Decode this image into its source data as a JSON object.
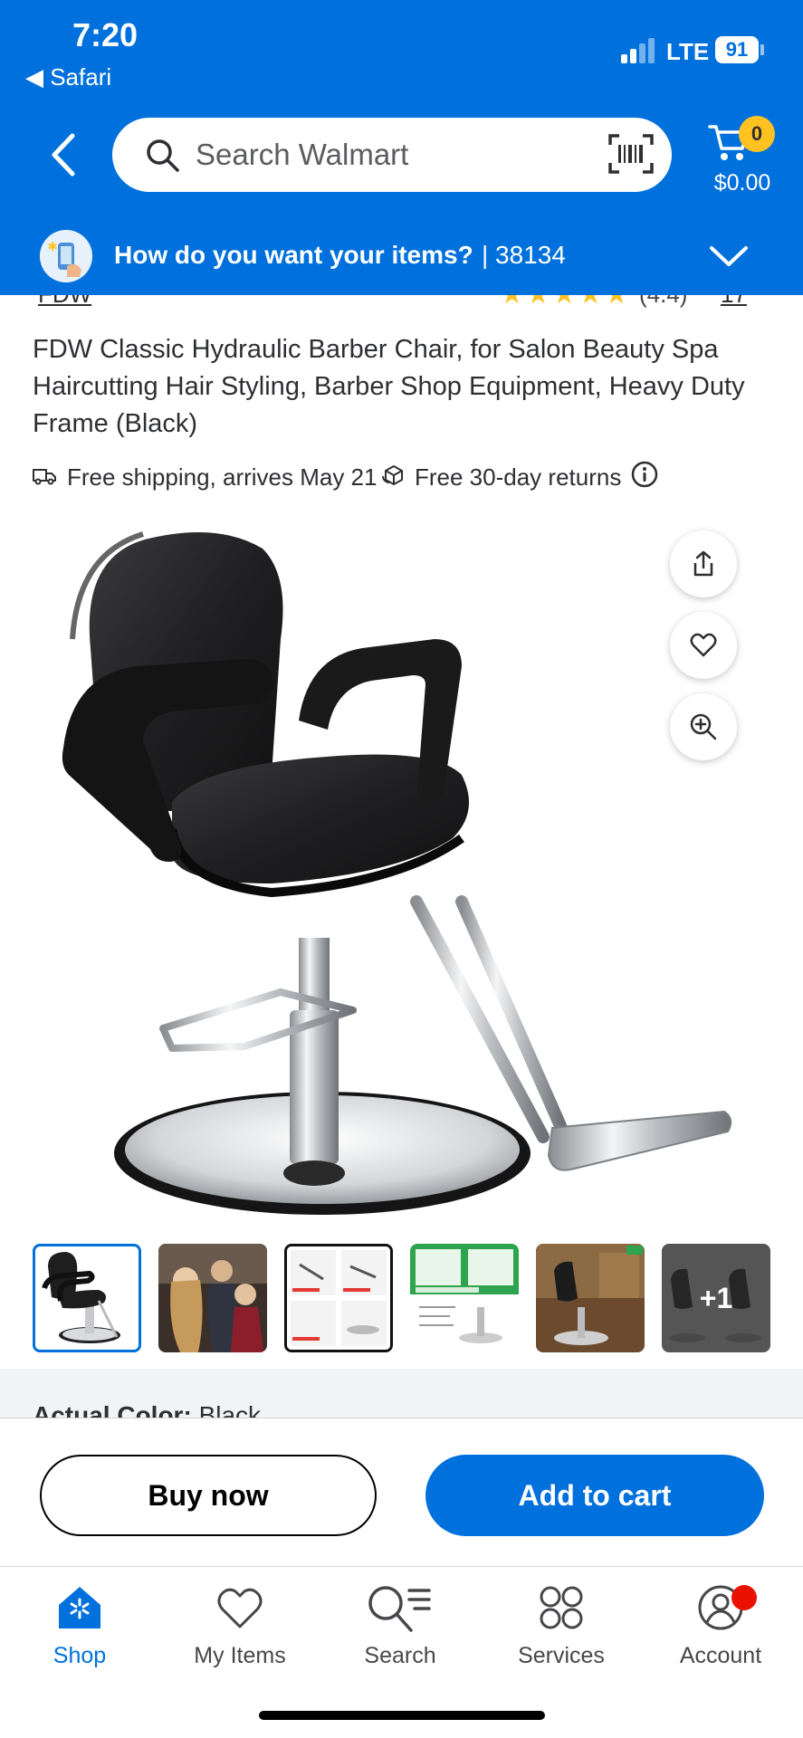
{
  "status_bar": {
    "time": "7:20",
    "back_app": "◀ Safari",
    "network": "LTE",
    "battery": "91"
  },
  "header": {
    "search": {
      "placeholder": "Search Walmart"
    },
    "cart": {
      "count": "0",
      "total": "$0.00"
    },
    "delivery": {
      "prompt": "How do you want your items?",
      "zip": "| 38134"
    },
    "brand_color": "#0071dc",
    "badge_color": "#ffc220"
  },
  "product": {
    "brand_peek": "FDW",
    "rating_peek": "(4.4)",
    "reviews_peek": "17",
    "title": "FDW Classic Hydraulic Barber Chair, for Salon Beauty Spa Haircutting Hair Styling, Barber Shop Equipment, Heavy Duty Frame (Black)",
    "shipping": "Free shipping, arrives May 21",
    "returns": "Free 30-day returns",
    "thumbnails_more": "+1",
    "color_label": "Actual Color:",
    "color_value": "Black"
  },
  "actions": {
    "buy_now": "Buy now",
    "add_to_cart": "Add to cart"
  },
  "tabbar": {
    "items": [
      {
        "label": "Shop",
        "icon": "shop-icon"
      },
      {
        "label": "My Items",
        "icon": "heart-icon"
      },
      {
        "label": "Search",
        "icon": "search-list-icon"
      },
      {
        "label": "Services",
        "icon": "services-icon"
      },
      {
        "label": "Account",
        "icon": "account-icon"
      }
    ]
  }
}
